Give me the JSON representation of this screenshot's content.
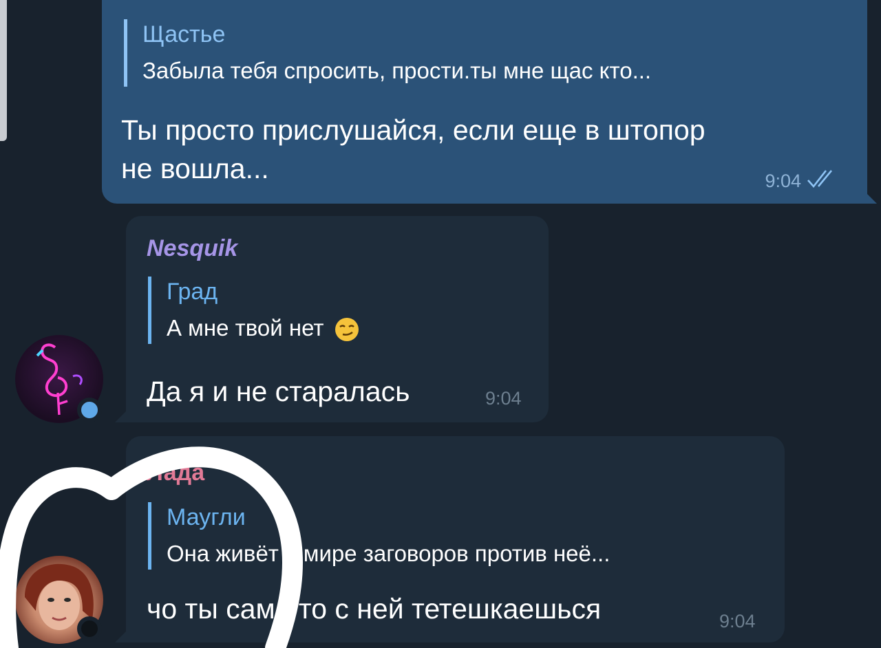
{
  "colors": {
    "background": "#18222d",
    "outgoing_bubble": "#2b5278",
    "incoming_bubble": "#1e2c3a",
    "reply_name_out": "#8fc4f5",
    "reply_name_in": "#6cb4f0",
    "sender_nesquik": "#a695e7",
    "sender_lada": "#e27a96",
    "read_ticks": "#8fc4f5",
    "time_out": "#8fb3d6",
    "time_in": "#6d7f8f",
    "annotation": "#ffffff"
  },
  "messages": [
    {
      "type": "outgoing",
      "reply_to": {
        "name": "Щастье",
        "text": "Забыла тебя спросить, прости.ты мне щас кто..."
      },
      "text_line1": "Ты просто прислушайся, если еще в штопор",
      "text_line2": "не вошла...",
      "time": "9:04",
      "status_icon": "double-check-read-icon"
    },
    {
      "type": "incoming",
      "sender": "Nesquik",
      "reply_to": {
        "name": "Град",
        "text": "А мне твой нет",
        "emoji": "smirking-face-icon"
      },
      "text": "Да я и не старалась",
      "time": "9:04",
      "avatar": "flamingo-neon-avatar",
      "online_status": "online"
    },
    {
      "type": "incoming",
      "sender": "Лада",
      "reply_to": {
        "name": "Маугли",
        "text": "Она живёт в мире заговоров против неё..."
      },
      "text": "чо ты сама то с ней тетешкаешься",
      "time": "9:04",
      "avatar": "woman-portrait-avatar",
      "online_status": "offline"
    }
  ]
}
